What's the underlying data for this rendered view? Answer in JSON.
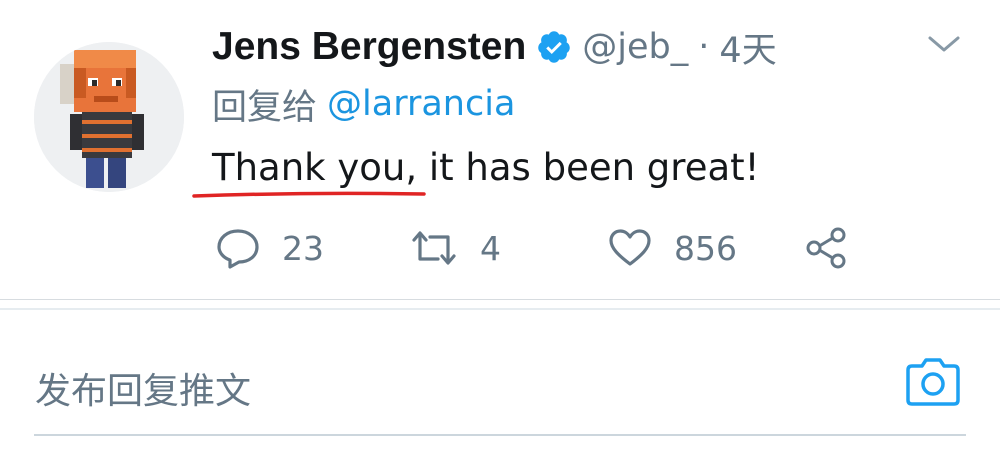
{
  "tweet": {
    "author_name": "Jens Bergensten",
    "handle": "@jeb_",
    "separator": "·",
    "time": "4天",
    "reply_label": "回复给",
    "reply_mention": "@larrancia",
    "text": "Thank you, it has been great!",
    "counts": {
      "replies": "23",
      "retweets": "4",
      "likes": "856"
    }
  },
  "composer": {
    "placeholder": "发布回复推文"
  },
  "colors": {
    "accent": "#1b95e0",
    "muted": "#657786",
    "text": "#14171a",
    "annotation_underline": "#e02424"
  },
  "icons": {
    "verified": "verified-badge-icon",
    "more": "chevron-down-icon",
    "reply": "reply-bubble-icon",
    "retweet": "retweet-icon",
    "like": "heart-icon",
    "share": "share-icon",
    "camera": "camera-icon"
  }
}
